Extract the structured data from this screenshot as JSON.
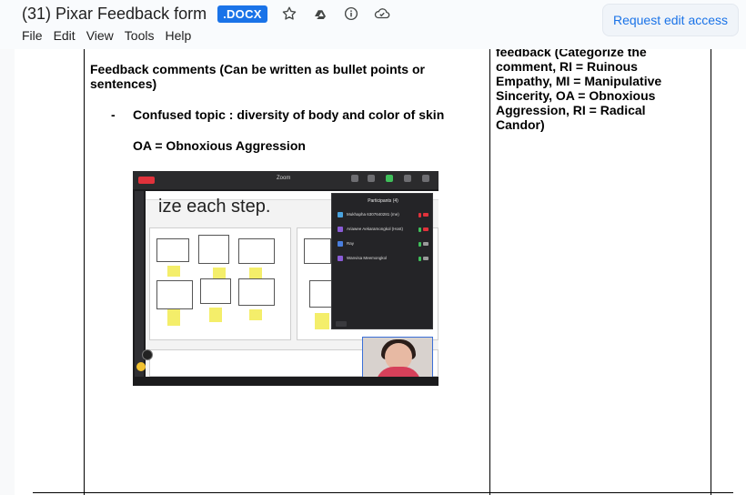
{
  "header": {
    "doc_title": "(31) Pixar Feedback form",
    "file_badge": ".DOCX",
    "icons": [
      "star-icon",
      "drive-move-icon",
      "info-icon",
      "cloud-status-icon"
    ],
    "request_button": "Request edit access",
    "menu": [
      "File",
      "Edit",
      "View",
      "Tools",
      "Help"
    ]
  },
  "document": {
    "right_column_text": "feedback (Categorize the comment, RI = Ruinous Empathy, MI = Manipulative Sincerity, OA = Obnoxious Aggression, RI = Radical Candor)",
    "feedback_heading": "Feedback comments (Can be written as bullet points or sentences)",
    "bullet_dash": "-",
    "bullet_text": "Confused topic : diversity of body  and color of skin",
    "category_line": "OA = Obnoxious Aggression"
  },
  "screenshot": {
    "slide_big_text": "ize each step.",
    "zoom_label": "Zoom",
    "participants_title": "Participants (4)",
    "participants": [
      {
        "name": "Mukhapha 6307640281 (me)",
        "color": "#4aa3df",
        "mic": "#e0323b"
      },
      {
        "name": "Ariawee Aekaramongkol (Host)",
        "color": "#8a5cd6",
        "mic": "#3fbf5a"
      },
      {
        "name": "Ray",
        "color": "#4a7fdf",
        "mic": "#3fbf5a"
      },
      {
        "name": "Wanvisa Meemongkol",
        "color": "#8a5cd6",
        "mic": "#3fbf5a"
      }
    ]
  }
}
